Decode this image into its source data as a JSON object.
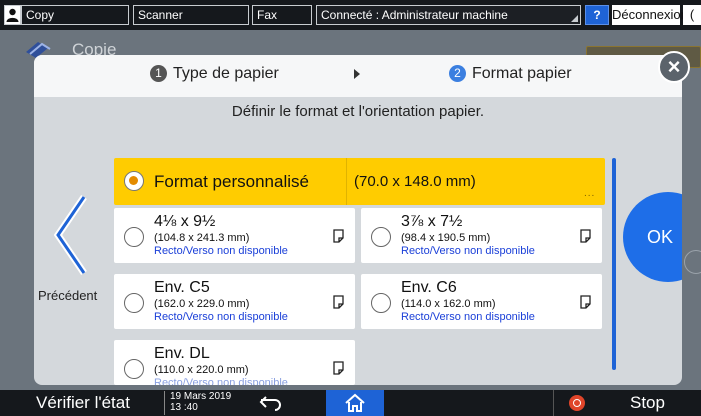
{
  "topbar": {
    "copy": "Copy",
    "scanner": "Scanner",
    "fax": "Fax",
    "status": "Connecté : Administrateur machine",
    "help": "?",
    "logout": "Déconnexion",
    "moon": "("
  },
  "background": {
    "title": "Copie"
  },
  "steps": {
    "step1_num": "1",
    "step1_label": "Type de papier",
    "step2_num": "2",
    "step2_label": "Format papier"
  },
  "instruction": "Définir le format et l'orientation papier.",
  "previous_label": "Précédent",
  "custom": {
    "label": "Format personnalisé",
    "value": "(70.0 x 148.0 mm)",
    "selected": true
  },
  "options": [
    {
      "title": "4⅛ x 9½",
      "dims": "(104.8 x 241.3 mm)",
      "note": "Recto/Verso non disponible"
    },
    {
      "title": "3⅞ x 7½",
      "dims": "(98.4 x 190.5 mm)",
      "note": "Recto/Verso non disponible"
    },
    {
      "title": "Env. C5",
      "dims": "(162.0 x 229.0 mm)",
      "note": "Recto/Verso non disponible"
    },
    {
      "title": "Env. C6",
      "dims": "(114.0 x 162.0 mm)",
      "note": "Recto/Verso non disponible"
    },
    {
      "title": "Env. DL",
      "dims": "(110.0 x 220.0 mm)",
      "note": "Recto/Verso non disponible"
    }
  ],
  "ok_label": "OK",
  "bottombar": {
    "verify": "Vérifier l'état",
    "date": "19 Mars 2019",
    "time": "13 :40",
    "stop": "Stop"
  },
  "colors": {
    "selected_bg": "#ffcc00",
    "accent_blue": "#1e6ee8",
    "note_blue": "#1a3fd8"
  }
}
